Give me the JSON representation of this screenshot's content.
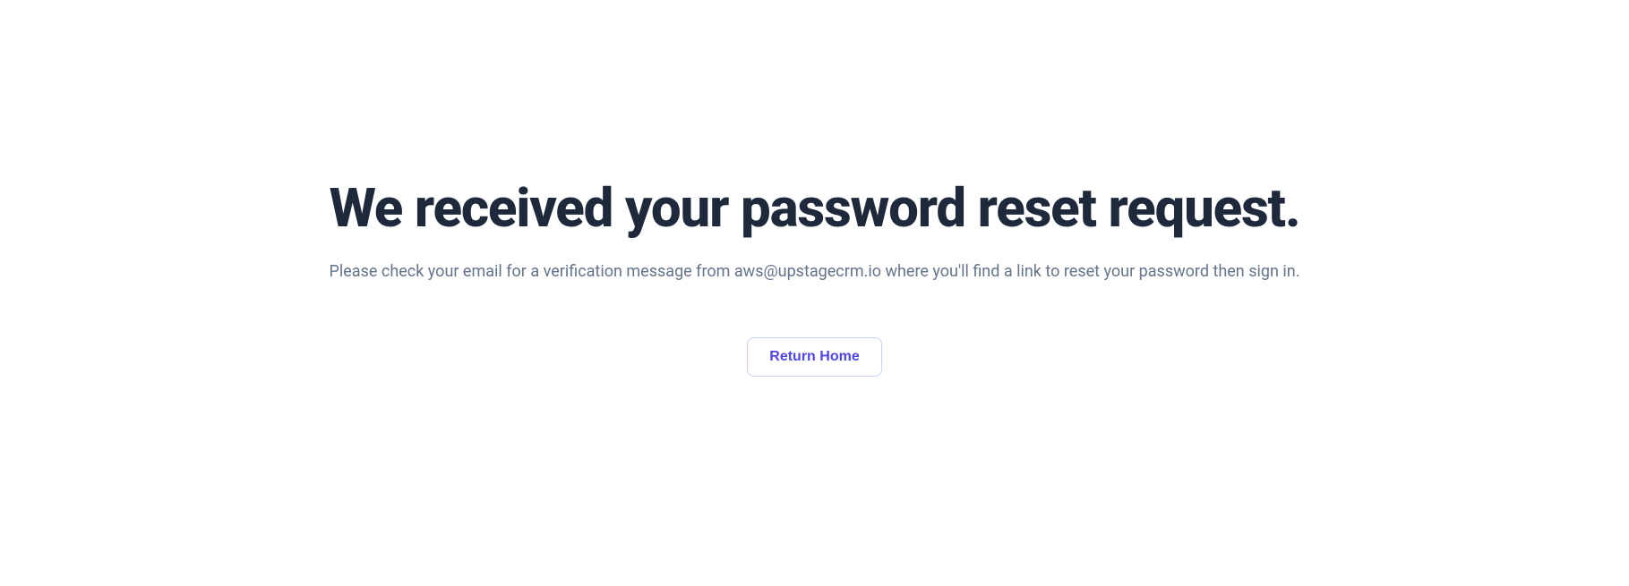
{
  "heading": "We received your password reset request.",
  "description": "Please check your email for a verification message from aws@upstagecrm.io where you'll find a link to reset your password then sign in.",
  "button_label": "Return Home"
}
